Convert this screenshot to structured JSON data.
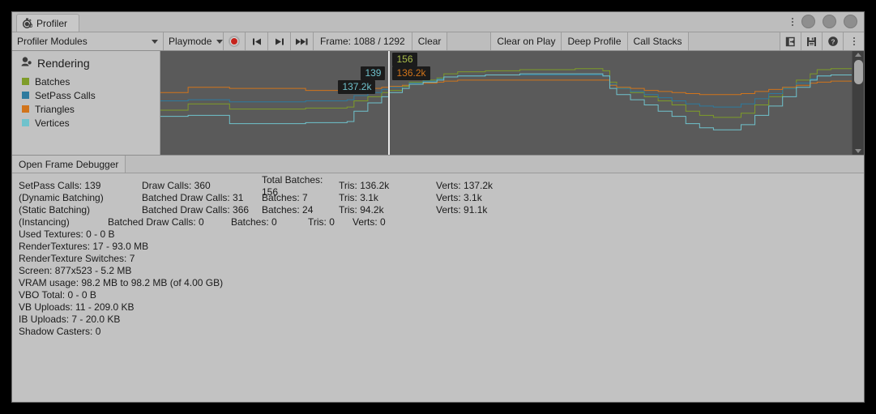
{
  "window": {
    "tab_label": "Profiler",
    "tab_icon": "stopwatch-icon"
  },
  "toolbar": {
    "modules_label": "Profiler Modules",
    "playmode_label": "Playmode",
    "record_icon": "record-icon",
    "prev_frame_icon": "skip-back-icon",
    "next_frame_icon": "skip-forward-icon",
    "last_frame_icon": "skip-to-end-icon",
    "frame_label": "Frame: 1088 / 1292",
    "clear_label": "Clear",
    "clear_on_play_label": "Clear on Play",
    "deep_profile_label": "Deep Profile",
    "call_stacks_label": "Call Stacks",
    "load_icon": "load-profile-icon",
    "save_icon": "save-profile-icon",
    "help_icon": "help-icon",
    "menu_icon": "kebab-menu-icon"
  },
  "module": {
    "title": "Rendering",
    "title_icon": "rendering-icon",
    "legend": [
      {
        "label": "Batches",
        "color": "#7e9c28"
      },
      {
        "label": "SetPass Calls",
        "color": "#2d7a9e"
      },
      {
        "label": "Triangles",
        "color": "#d1741b"
      },
      {
        "label": "Vertices",
        "color": "#6fc2cc"
      }
    ]
  },
  "chart_data": {
    "type": "line",
    "title": "Rendering",
    "xlabel": "",
    "ylabel": "",
    "grid": false,
    "legend_position": "left-panel",
    "background": "#5a5a5a",
    "cursor_frame": 1088,
    "cursor_x_pct": 33.0,
    "tooltips": [
      {
        "series": "Batches",
        "value": "156",
        "color": "#a9bd4a"
      },
      {
        "series": "SetPass Calls",
        "value": "139",
        "color": "#6fc2cc"
      },
      {
        "series": "Triangles",
        "value": "136.2k",
        "color": "#d1741b"
      },
      {
        "series": "Vertices",
        "value": "137.2k",
        "color": "#6fc2cc"
      }
    ],
    "series": [
      {
        "name": "Batches",
        "color": "#7e9c28",
        "points": [
          [
            0,
            57
          ],
          [
            3,
            57
          ],
          [
            4,
            51
          ],
          [
            9,
            51
          ],
          [
            10,
            56
          ],
          [
            20,
            56
          ],
          [
            21,
            55
          ],
          [
            27,
            54
          ],
          [
            28,
            48
          ],
          [
            30,
            44
          ],
          [
            32,
            40
          ],
          [
            33,
            38
          ],
          [
            35,
            34
          ],
          [
            36,
            30
          ],
          [
            38,
            28
          ],
          [
            40,
            26
          ],
          [
            41,
            22
          ],
          [
            43,
            20
          ],
          [
            47,
            19
          ],
          [
            52,
            18
          ],
          [
            58,
            18
          ],
          [
            60,
            17
          ],
          [
            62,
            17
          ],
          [
            64,
            19
          ],
          [
            65,
            30
          ],
          [
            66,
            36
          ],
          [
            68,
            40
          ],
          [
            70,
            44
          ],
          [
            72,
            48
          ],
          [
            74,
            52
          ],
          [
            76,
            58
          ],
          [
            78,
            62
          ],
          [
            80,
            64
          ],
          [
            82,
            64
          ],
          [
            84,
            60
          ],
          [
            86,
            52
          ],
          [
            88,
            44
          ],
          [
            90,
            36
          ],
          [
            92,
            28
          ],
          [
            94,
            22
          ],
          [
            95,
            18
          ],
          [
            97,
            17
          ],
          [
            100,
            17
          ]
        ]
      },
      {
        "name": "SetPass Calls",
        "color": "#2d7a9e",
        "points": [
          [
            0,
            48
          ],
          [
            3,
            48
          ],
          [
            4,
            47
          ],
          [
            9,
            47
          ],
          [
            10,
            49
          ],
          [
            20,
            49
          ],
          [
            21,
            48
          ],
          [
            27,
            47
          ],
          [
            28,
            43
          ],
          [
            30,
            40
          ],
          [
            32,
            37
          ],
          [
            33,
            35
          ],
          [
            35,
            33
          ],
          [
            36,
            31
          ],
          [
            38,
            29
          ],
          [
            40,
            27
          ],
          [
            41,
            25
          ],
          [
            43,
            24
          ],
          [
            47,
            23
          ],
          [
            52,
            23
          ],
          [
            58,
            23
          ],
          [
            60,
            23
          ],
          [
            62,
            23
          ],
          [
            64,
            24
          ],
          [
            65,
            32
          ],
          [
            66,
            36
          ],
          [
            68,
            39
          ],
          [
            70,
            42
          ],
          [
            72,
            45
          ],
          [
            74,
            48
          ],
          [
            76,
            51
          ],
          [
            78,
            53
          ],
          [
            80,
            54
          ],
          [
            82,
            54
          ],
          [
            84,
            51
          ],
          [
            86,
            46
          ],
          [
            88,
            41
          ],
          [
            90,
            36
          ],
          [
            92,
            31
          ],
          [
            94,
            27
          ],
          [
            95,
            24
          ],
          [
            97,
            23
          ],
          [
            100,
            23
          ]
        ]
      },
      {
        "name": "Triangles",
        "color": "#d1741b",
        "points": [
          [
            0,
            40
          ],
          [
            3,
            40
          ],
          [
            4,
            35
          ],
          [
            9,
            35
          ],
          [
            10,
            36
          ],
          [
            20,
            36
          ],
          [
            21,
            38
          ],
          [
            27,
            38
          ],
          [
            28,
            37
          ],
          [
            30,
            36
          ],
          [
            32,
            35
          ],
          [
            33,
            34
          ],
          [
            35,
            33
          ],
          [
            36,
            32
          ],
          [
            38,
            31
          ],
          [
            40,
            30
          ],
          [
            41,
            29
          ],
          [
            43,
            28
          ],
          [
            47,
            28
          ],
          [
            52,
            28
          ],
          [
            58,
            28
          ],
          [
            60,
            28
          ],
          [
            62,
            28
          ],
          [
            64,
            28
          ],
          [
            65,
            33
          ],
          [
            66,
            35
          ],
          [
            68,
            36
          ],
          [
            70,
            38
          ],
          [
            72,
            39
          ],
          [
            74,
            40
          ],
          [
            76,
            41
          ],
          [
            78,
            42
          ],
          [
            80,
            42
          ],
          [
            82,
            42
          ],
          [
            84,
            41
          ],
          [
            86,
            39
          ],
          [
            88,
            37
          ],
          [
            90,
            35
          ],
          [
            92,
            33
          ],
          [
            94,
            31
          ],
          [
            95,
            30
          ],
          [
            97,
            29
          ],
          [
            100,
            29
          ]
        ]
      },
      {
        "name": "Vertices",
        "color": "#6fc2cc",
        "points": [
          [
            0,
            63
          ],
          [
            3,
            63
          ],
          [
            4,
            62
          ],
          [
            9,
            62
          ],
          [
            10,
            70
          ],
          [
            20,
            70
          ],
          [
            21,
            69
          ],
          [
            27,
            68
          ],
          [
            28,
            58
          ],
          [
            30,
            50
          ],
          [
            32,
            44
          ],
          [
            33,
            40
          ],
          [
            35,
            36
          ],
          [
            36,
            32
          ],
          [
            38,
            30
          ],
          [
            40,
            28
          ],
          [
            41,
            25
          ],
          [
            43,
            24
          ],
          [
            47,
            23
          ],
          [
            52,
            22
          ],
          [
            58,
            22
          ],
          [
            60,
            22
          ],
          [
            62,
            22
          ],
          [
            64,
            24
          ],
          [
            65,
            36
          ],
          [
            66,
            42
          ],
          [
            68,
            47
          ],
          [
            70,
            52
          ],
          [
            72,
            58
          ],
          [
            74,
            63
          ],
          [
            76,
            70
          ],
          [
            78,
            74
          ],
          [
            80,
            76
          ],
          [
            82,
            76
          ],
          [
            84,
            71
          ],
          [
            86,
            62
          ],
          [
            88,
            53
          ],
          [
            90,
            44
          ],
          [
            92,
            35
          ],
          [
            94,
            28
          ],
          [
            95,
            24
          ],
          [
            97,
            23
          ],
          [
            100,
            23
          ]
        ]
      }
    ]
  },
  "frame_debugger": {
    "open_label": "Open Frame Debugger"
  },
  "stats": {
    "rows": [
      {
        "cells": [
          "SetPass Calls: 139",
          "Draw Calls: 360",
          "Total Batches: 156",
          "Tris: 136.2k",
          "Verts: 137.2k"
        ]
      },
      {
        "cells": [
          "(Dynamic Batching)",
          "Batched Draw Calls: 31",
          "Batches: 7",
          "Tris: 3.1k",
          "Verts: 3.1k"
        ]
      },
      {
        "cells": [
          "(Static Batching)",
          "Batched Draw Calls: 366",
          "Batches: 24",
          "Tris: 94.2k",
          "Verts: 91.1k"
        ]
      }
    ],
    "instancing_row": {
      "cells": [
        "(Instancing)",
        "Batched Draw Calls: 0",
        "Batches: 0",
        "Tris: 0",
        "Verts: 0"
      ]
    },
    "lines": [
      "Used Textures: 0 - 0 B",
      "RenderTextures: 17 - 93.0 MB",
      "RenderTexture Switches: 7",
      "Screen: 877x523 - 5.2 MB",
      "VRAM usage: 98.2 MB to 98.2 MB (of 4.00 GB)",
      "VBO Total: 0 - 0 B",
      "VB Uploads: 11 - 209.0 KB",
      "IB Uploads: 7 - 20.0 KB",
      "Shadow Casters: 0"
    ]
  }
}
